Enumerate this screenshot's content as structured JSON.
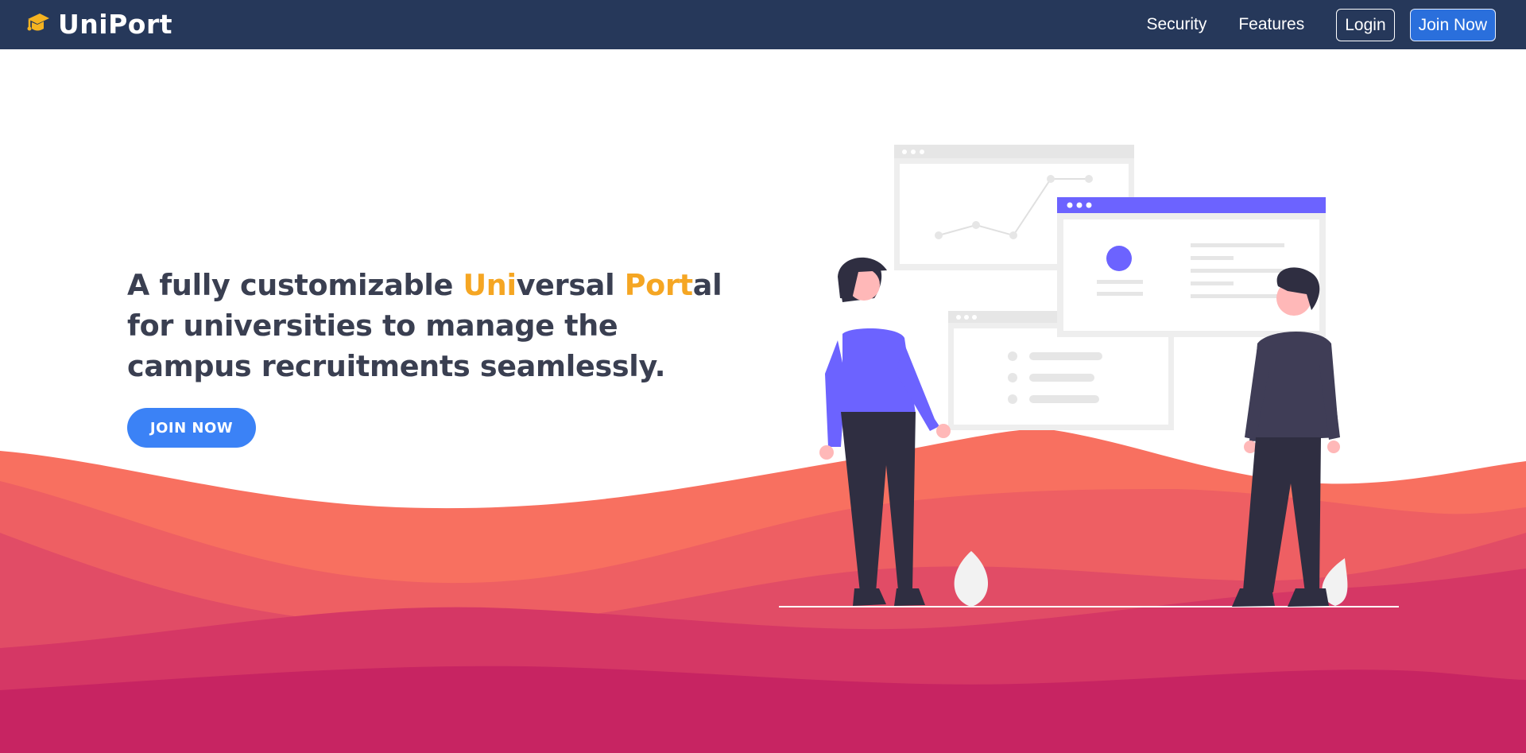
{
  "brand": {
    "name": "UniPort",
    "icon": "graduation-cap-icon",
    "color": "#f5b321"
  },
  "nav": {
    "links": [
      {
        "label": "Security"
      },
      {
        "label": "Features"
      }
    ],
    "login_label": "Login",
    "join_label": "Join Now"
  },
  "hero": {
    "headline_parts": [
      "A fully customizable ",
      "Uni",
      "versal ",
      "Port",
      "al for universities to manage the campus recruitments seamlessly."
    ],
    "cta_label": "JOIN NOW"
  },
  "colors": {
    "navbar": "#26385a",
    "accent": "#f5a623",
    "cta": "#3b82f6",
    "illustration_accent": "#6c63ff",
    "wave_1": "#f87060",
    "wave_2": "#ee5f63",
    "wave_3": "#e14c66",
    "wave_4": "#d53765",
    "wave_5": "#c72462"
  }
}
